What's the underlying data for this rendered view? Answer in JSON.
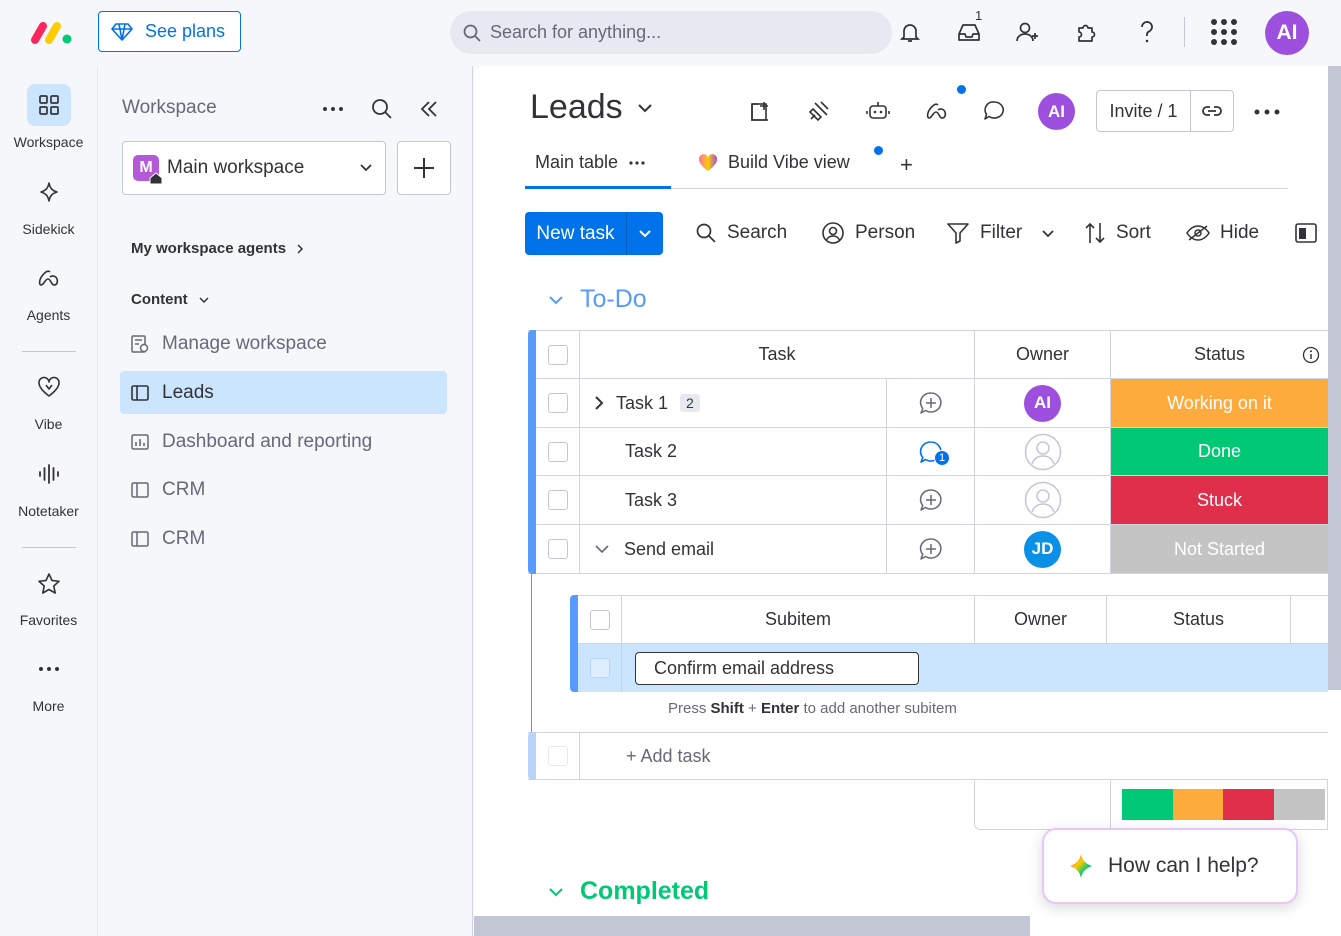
{
  "topbar": {
    "see_plans": "See plans",
    "search_placeholder": "Search for anything...",
    "inbox_count": "1",
    "user_initials": "AI"
  },
  "rail": {
    "items": [
      {
        "label": "Workspace",
        "icon": "grid-icon"
      },
      {
        "label": "Sidekick",
        "icon": "sparkle-icon"
      },
      {
        "label": "Agents",
        "icon": "agents-icon"
      },
      {
        "label": "Vibe",
        "icon": "heart-icon"
      },
      {
        "label": "Notetaker",
        "icon": "waveform-icon"
      },
      {
        "label": "Favorites",
        "icon": "star-icon"
      },
      {
        "label": "More",
        "icon": "ellipsis-icon"
      }
    ]
  },
  "workspace": {
    "heading": "Workspace",
    "selected": "Main workspace",
    "selected_initial": "M",
    "agents_link": "My workspace agents",
    "content_label": "Content",
    "nav": [
      "Manage workspace",
      "Leads",
      "Dashboard and reporting",
      "CRM",
      "CRM"
    ]
  },
  "board": {
    "title": "Leads",
    "user_initials": "AI",
    "invite_label": "Invite / 1",
    "tabs": [
      "Main table",
      "Build Vibe view"
    ],
    "add_tab": "+",
    "toolbar": {
      "new_task": "New task",
      "search": "Search",
      "person": "Person",
      "filter": "Filter",
      "sort": "Sort",
      "hide": "Hide"
    }
  },
  "group_todo": {
    "title": "To-Do",
    "color": "#579bfc",
    "columns": {
      "task": "Task",
      "owner": "Owner",
      "status": "Status"
    },
    "rows": [
      {
        "task": "Task 1",
        "subitems": "2",
        "owner": "AI",
        "status": "Working on it",
        "status_color": "#fdab3d"
      },
      {
        "task": "Task 2",
        "updates": "1",
        "owner": "",
        "status": "Done",
        "status_color": "#00c875"
      },
      {
        "task": "Task 3",
        "owner": "",
        "status": "Stuck",
        "status_color": "#df2f4a"
      },
      {
        "task": "Send email",
        "owner": "JD",
        "status": "Not Started",
        "status_color": "#c4c4c4"
      }
    ],
    "subitems": {
      "columns": {
        "subitem": "Subitem",
        "owner": "Owner",
        "status": "Status"
      },
      "editing_value": "Confirm email address",
      "hint_pre": "Press ",
      "hint_shift": "Shift",
      "hint_plus": " + ",
      "hint_enter": "Enter",
      "hint_post": " to add another subitem"
    },
    "add_task": "+ Add task",
    "summary_colors": [
      "#00c875",
      "#fdab3d",
      "#df2f4a",
      "#c4c4c4"
    ]
  },
  "group_completed": {
    "title": "Completed",
    "color": "#00c875"
  },
  "assistant": {
    "prompt": "How can I help?"
  }
}
